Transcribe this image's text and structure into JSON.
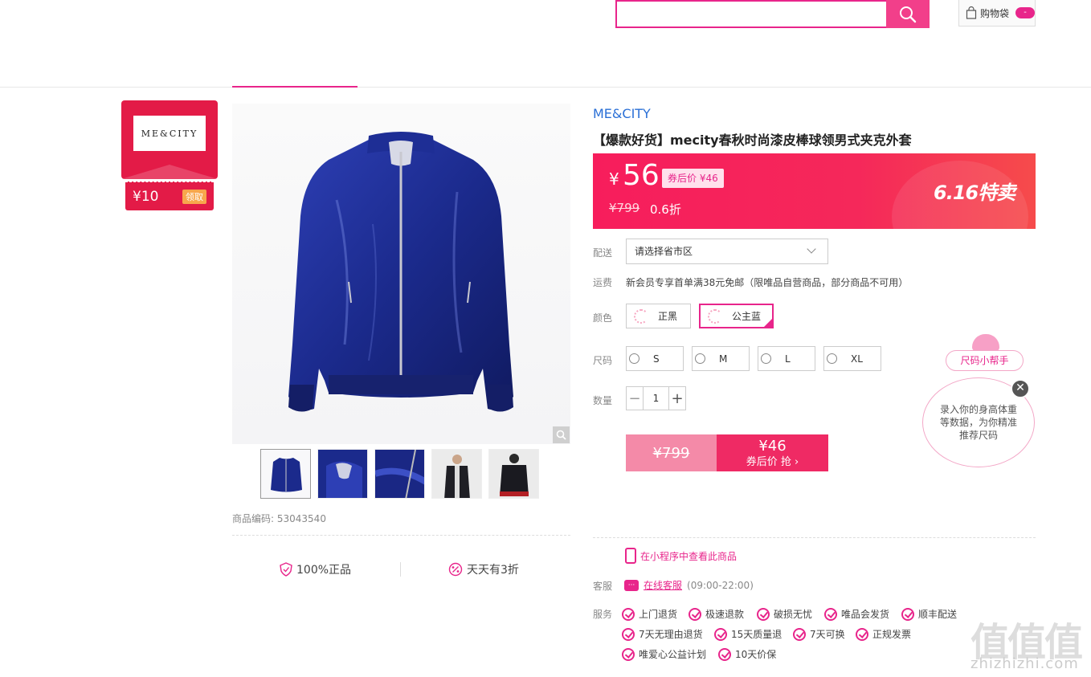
{
  "header": {
    "search_placeholder": "",
    "cart_label": "购物袋",
    "cart_count": "-"
  },
  "brand_card": {
    "logo_text": "ME&CITY",
    "coupon_amount": "¥10",
    "coupon_button": "领取"
  },
  "gallery": {
    "thumbnails": [
      "jacket-front",
      "collar-detail",
      "fabric-detail",
      "model-front",
      "model-back"
    ],
    "sku_label": "商品编码:",
    "sku_value": "53043540"
  },
  "guarantees": [
    {
      "label": "100%正品",
      "icon": "shield-icon"
    },
    {
      "label": "天天有3折",
      "icon": "discount-icon"
    }
  ],
  "product": {
    "brand": "ME&CITY",
    "title": "【爆款好货】mecity春秋时尚漆皮棒球领男式夹克外套",
    "price_symbol": "¥",
    "price": "56",
    "after_coupon_label": "券后价 ¥46",
    "original_price": "¥799",
    "discount": "0.6折",
    "promo_label": "6.16特卖"
  },
  "delivery": {
    "label": "配送",
    "value": "请选择省市区"
  },
  "shipping": {
    "label": "运费",
    "text": "新会员专享首单满38元免邮（限唯品自营商品，部分商品不可用）"
  },
  "color": {
    "label": "颜色",
    "options": [
      "正黑",
      "公主蓝"
    ],
    "selected": "公主蓝"
  },
  "size": {
    "label": "尺码",
    "options": [
      "S",
      "M",
      "L",
      "XL"
    ]
  },
  "quantity": {
    "label": "数量",
    "value": "1",
    "minus": "−",
    "plus": "+"
  },
  "buy": {
    "original": "¥799",
    "price": "¥46",
    "cta": "券后价 抢 ›"
  },
  "miniprogram": "在小程序中查看此商品",
  "customer_service": {
    "label": "客服",
    "link": "在线客服",
    "hours": "(09:00-22:00)"
  },
  "services": {
    "label": "服务",
    "row1": [
      "上门退货",
      "极速退款",
      "破损无忧",
      "唯品会发货",
      "顺丰配送"
    ],
    "row2": [
      "7天无理由退货",
      "15天质量退",
      "7天可换",
      "正规发票"
    ],
    "row3": [
      "唯爱心公益计划",
      "10天价保"
    ]
  },
  "size_helper": {
    "title": "尺码小帮手",
    "message": "录入你的身高体重等数据，为你精准推荐尺码",
    "close": "✕"
  },
  "watermark": {
    "chars": "值值值",
    "url": "zhizhizhi.com"
  },
  "colors": {
    "accent": "#e8258b",
    "price_band": "#f71d5c",
    "brand_red": "#e31b47",
    "link_blue": "#2a6fd6",
    "jacket_blue": "#1b2a8c"
  }
}
